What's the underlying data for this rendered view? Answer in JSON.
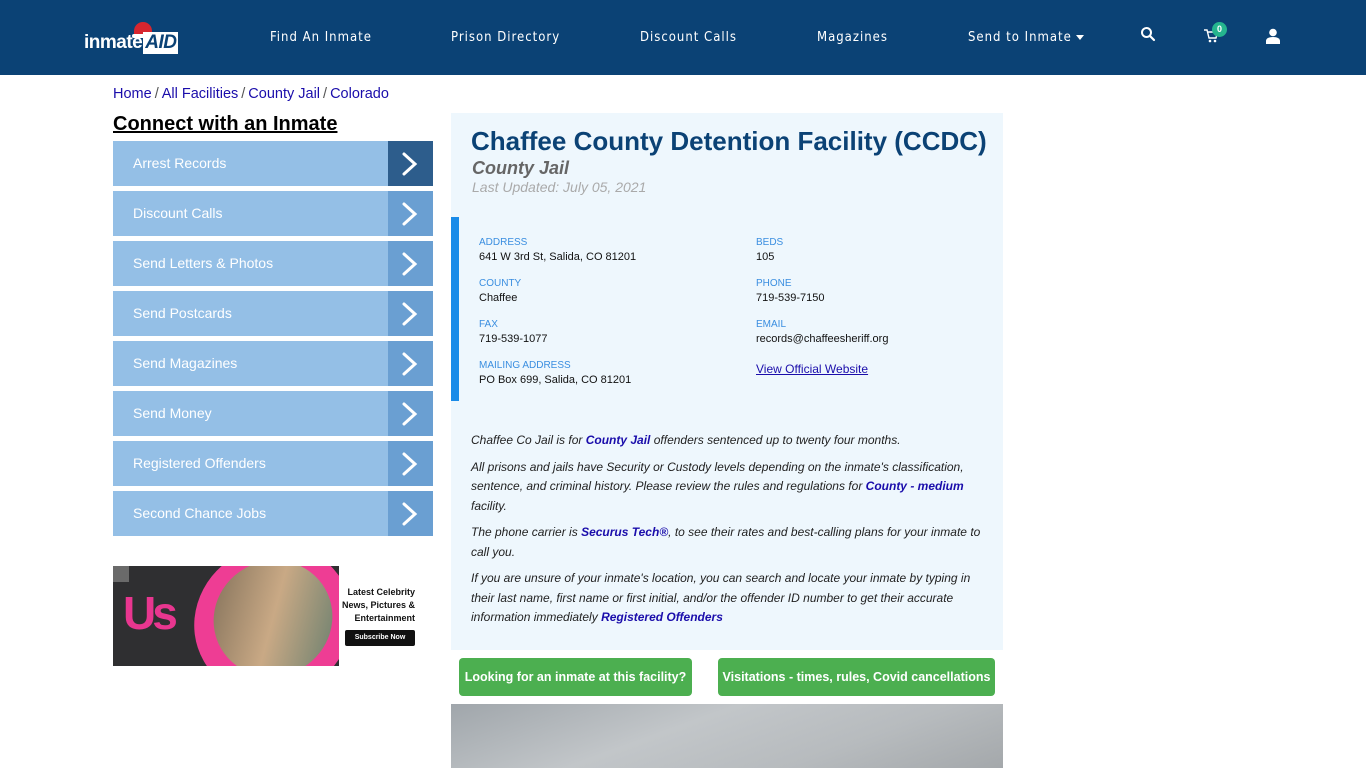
{
  "header": {
    "logo_text": "inmate",
    "logo_accent": "AID",
    "nav": [
      "Find An Inmate",
      "Prison Directory",
      "Discount Calls",
      "Magazines",
      "Send to Inmate"
    ],
    "cart_count": "0",
    "icons": [
      "search-icon",
      "cart-icon",
      "user-icon"
    ]
  },
  "breadcrumb": [
    "Home",
    "All Facilities",
    "County Jail",
    "Colorado"
  ],
  "sidebar": {
    "title": "Connect with an Inmate",
    "items": [
      "Arrest Records",
      "Discount Calls",
      "Send Letters & Photos",
      "Send Postcards",
      "Send Magazines",
      "Send Money",
      "Registered Offenders",
      "Second Chance Jobs"
    ]
  },
  "ad": {
    "brand": "Us",
    "headline": "Latest Celebrity News, Pictures & Entertainment",
    "cta": "Subscribe Now"
  },
  "facility": {
    "name": "Chaffee County Detention Facility (CCDC)",
    "type": "County Jail",
    "updated": "Last Updated: July 05, 2021",
    "info": {
      "address_label": "ADDRESS",
      "address": "641 W 3rd St, Salida, CO 81201",
      "beds_label": "BEDS",
      "beds": "105",
      "county_label": "COUNTY",
      "county": "Chaffee",
      "phone_label": "PHONE",
      "phone": "719-539-7150",
      "fax_label": "FAX",
      "fax": "719-539-1077",
      "email_label": "EMAIL",
      "email": "records@chaffeesheriff.org",
      "mailing_label": "MAILING ADDRESS",
      "mailing": "PO Box 699, Salida, CO 81201",
      "website_link": "View Official Website"
    },
    "desc": {
      "p1_a": "Chaffee Co Jail is for ",
      "p1_link": "County Jail",
      "p1_b": " offenders sentenced up to twenty four months.",
      "p2_a": "All prisons and jails have Security or Custody levels depending on the inmate's classification, sentence, and criminal history. Please review the rules and regulations for ",
      "p2_link": "County - medium",
      "p2_b": " facility.",
      "p3_a": "The phone carrier is ",
      "p3_link": "Securus Tech®",
      "p3_b": ", to see their rates and best-calling plans for your inmate to call you.",
      "p4_a": "If you are unsure of your inmate's location, you can search and locate your inmate by typing in their last name, first name or first initial, and/or the offender ID number to get their accurate information immediately ",
      "p4_link": "Registered Offenders"
    }
  },
  "buttons": {
    "find_inmate": "Looking for an inmate at this facility?",
    "visitations": "Visitations - times, rules, Covid cancellations"
  }
}
